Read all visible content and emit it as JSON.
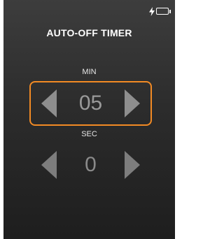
{
  "header": {
    "title": "AUTO-OFF TIMER"
  },
  "status_bar": {
    "icons": [
      "charging-bolt-icon",
      "battery-icon"
    ],
    "battery_level": 1.0
  },
  "timer": {
    "minutes": {
      "label": "MIN",
      "value": "05",
      "selected": true
    },
    "seconds": {
      "label": "SEC",
      "value": "0",
      "selected": false
    }
  },
  "colors": {
    "accent": "#f28a24",
    "background_top": "#3d3d3d",
    "background_bottom": "#1e1e1e",
    "arrow": "#8e8e8e"
  }
}
